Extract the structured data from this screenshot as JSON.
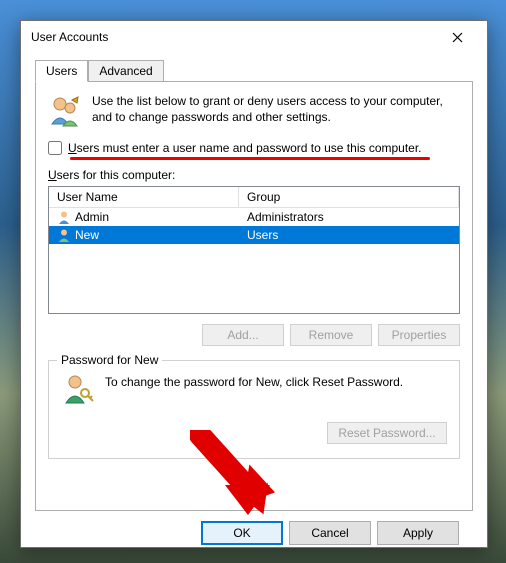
{
  "window": {
    "title": "User Accounts"
  },
  "tabs": {
    "users": "Users",
    "advanced": "Advanced"
  },
  "intro": "Use the list below to grant or deny users access to your computer, and to change passwords and other settings.",
  "checkbox": {
    "prefix": "U",
    "rest": "sers must enter a user name and password to use this computer.",
    "checked": false
  },
  "usersLabel": {
    "prefix": "U",
    "rest": "sers for this computer:"
  },
  "columns": {
    "name": "User Name",
    "group": "Group"
  },
  "rows": [
    {
      "name": "Admin",
      "group": "Administrators",
      "selected": false
    },
    {
      "name": "New",
      "group": "Users",
      "selected": true
    }
  ],
  "buttons": {
    "add": "Add...",
    "remove": "Remove",
    "properties": "Properties",
    "resetPassword": "Reset Password...",
    "ok": "OK",
    "cancel": "Cancel",
    "apply": "Apply"
  },
  "passwordBox": {
    "legend": "Password for New",
    "text": "To change the password for New, click Reset Password."
  }
}
